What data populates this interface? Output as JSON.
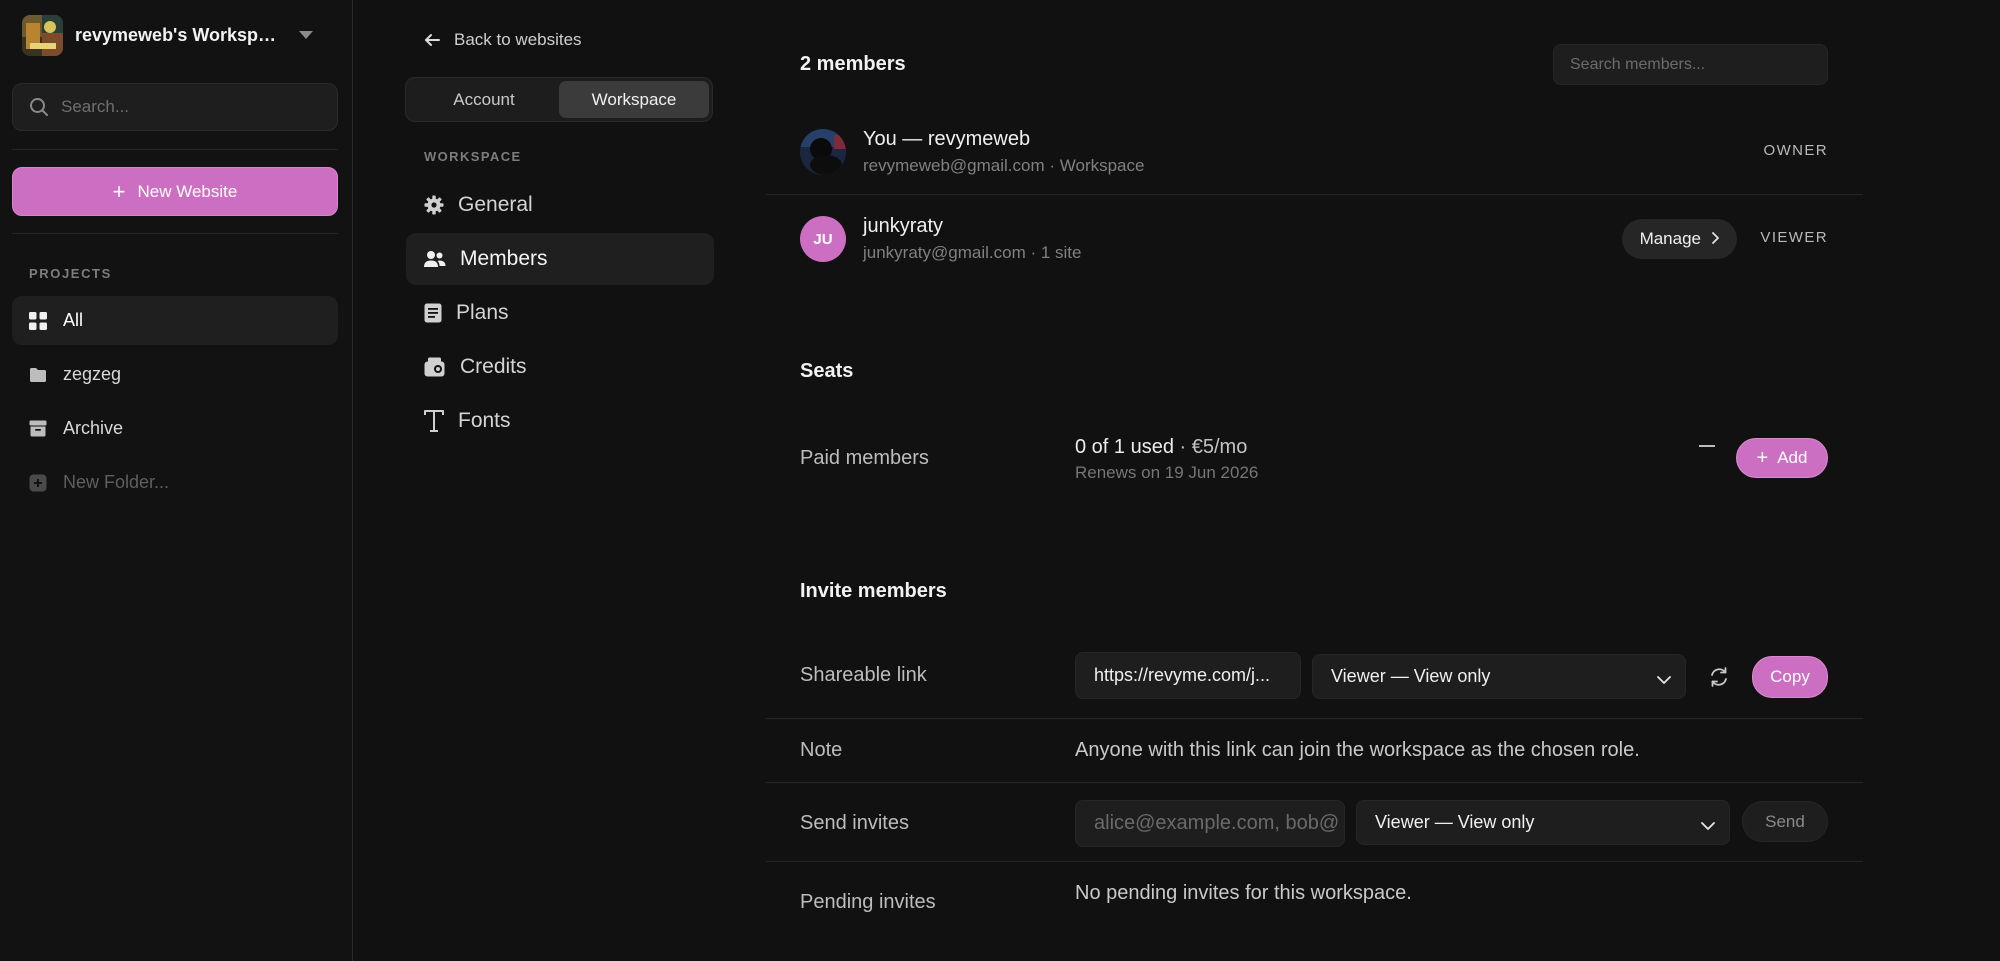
{
  "sidebar": {
    "workspace_name": "revymeweb's Workspac...",
    "search_placeholder": "Search...",
    "new_website_label": "New Website",
    "projects_label": "PROJECTS",
    "items": [
      {
        "label": "All",
        "icon": "grid-icon"
      },
      {
        "label": "zegzeg",
        "icon": "folder-icon"
      },
      {
        "label": "Archive",
        "icon": "archive-icon"
      },
      {
        "label": "New Folder...",
        "icon": "add-folder-icon"
      }
    ]
  },
  "settings_nav": {
    "back_label": "Back to websites",
    "tabs": [
      "Account",
      "Workspace"
    ],
    "active_tab": "Workspace",
    "section_label": "WORKSPACE",
    "items": [
      {
        "label": "General",
        "icon": "gear-icon"
      },
      {
        "label": "Members",
        "icon": "users-icon"
      },
      {
        "label": "Plans",
        "icon": "document-icon"
      },
      {
        "label": "Credits",
        "icon": "wallet-icon"
      },
      {
        "label": "Fonts",
        "icon": "type-icon"
      }
    ],
    "active_item": "Members"
  },
  "members": {
    "title": "2 members",
    "search_placeholder": "Search members...",
    "list": [
      {
        "name": "You — revymeweb",
        "sub": "revymeweb@gmail.com · Workspace",
        "role": "OWNER"
      },
      {
        "initials": "JU",
        "name": "junkyraty",
        "sub": "junkyraty@gmail.com · 1 site",
        "role": "VIEWER",
        "action": "Manage"
      }
    ]
  },
  "seats": {
    "title": "Seats",
    "label": "Paid members",
    "used": "0 of 1 used",
    "price": "· €5/mo",
    "renews": "Renews on 19 Jun 2026",
    "add_label": "Add"
  },
  "invite": {
    "title": "Invite members",
    "link_label": "Shareable link",
    "link_value": "https://revyme.com/j...",
    "link_role": "Viewer — View only",
    "copy_label": "Copy",
    "note_label": "Note",
    "note_text": "Anyone with this link can join the workspace as the chosen role.",
    "send_label": "Send invites",
    "send_placeholder": "alice@example.com, bob@",
    "send_role": "Viewer — View only",
    "send_button": "Send",
    "pending_label": "Pending invites",
    "pending_text": "No pending invites for this workspace."
  },
  "colors": {
    "accent": "#cc6fc2",
    "background": "#111111"
  }
}
